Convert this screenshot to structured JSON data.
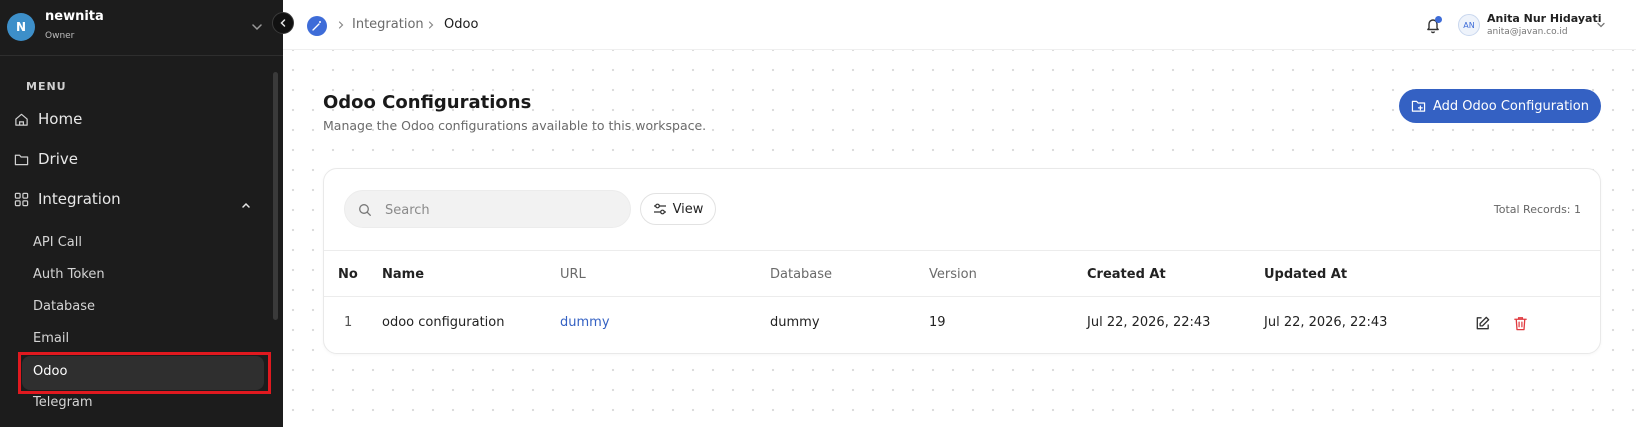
{
  "workspace": {
    "avatar_letter": "N",
    "name": "newnita",
    "role": "Owner"
  },
  "sidebar": {
    "menu_label": "MENU",
    "items": [
      {
        "label": "Home",
        "icon": "home-icon"
      },
      {
        "label": "Drive",
        "icon": "folder-icon"
      },
      {
        "label": "Integration",
        "icon": "grid-icon"
      }
    ],
    "subitems": [
      {
        "label": "API Call"
      },
      {
        "label": "Auth Token"
      },
      {
        "label": "Database"
      },
      {
        "label": "Email"
      },
      {
        "label": "Odoo"
      },
      {
        "label": "Telegram"
      }
    ],
    "active_subitem": "Odoo"
  },
  "breadcrumb": {
    "items": [
      "Integration",
      "Odoo"
    ]
  },
  "user": {
    "initials": "AN",
    "name": "Anita Nur Hidayati",
    "email": "anita@javan.co.id"
  },
  "page": {
    "title": "Odoo Configurations",
    "subtitle": "Manage the Odoo configurations available to this workspace.",
    "add_button": "Add Odoo Configuration"
  },
  "toolbar": {
    "search_placeholder": "Search",
    "view_label": "View",
    "total_records": "Total Records: 1"
  },
  "table": {
    "columns": [
      "No",
      "Name",
      "URL",
      "Database",
      "Version",
      "Created At",
      "Updated At"
    ],
    "rows": [
      {
        "no": "1",
        "name": "odoo configuration",
        "url": "dummy",
        "database": "dummy",
        "version": "19",
        "created_at": "Jul 22, 2026, 22:43",
        "updated_at": "Jul 22, 2026, 22:43"
      }
    ]
  },
  "colors": {
    "sidebar_bg": "#1c1c1c",
    "accent": "#3461c3",
    "delete": "#e0393e",
    "highlight": "#e0191f"
  }
}
